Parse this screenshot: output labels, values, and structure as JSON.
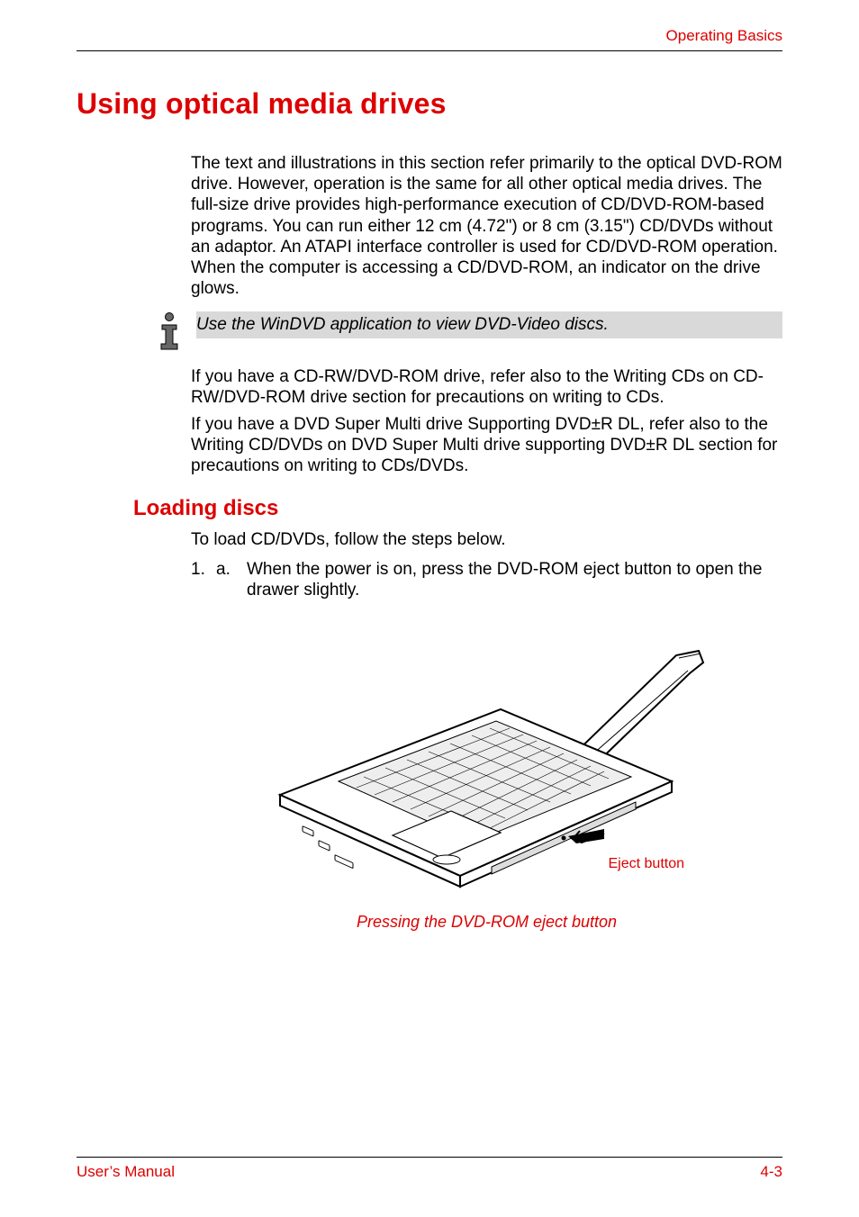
{
  "header": {
    "section": "Operating Basics"
  },
  "headings": {
    "main": "Using optical media drives",
    "sub1": "Loading discs"
  },
  "paragraphs": {
    "intro": "The text and illustrations in this section refer primarily to the optical DVD-ROM drive. However, operation is the same for all other optical media drives. The full-size drive provides high-performance execution of CD/DVD-ROM-based programs. You can run either 12 cm (4.72\") or 8 cm (3.15\") CD/DVDs without an adaptor. An ATAPI interface controller is used for CD/DVD-ROM operation. When the computer is accessing a CD/DVD-ROM, an indicator on the drive glows.",
    "note": "Use the WinDVD application to view DVD-Video discs.",
    "after_note_1": "If you have a CD-RW/DVD-ROM drive, refer also to the Writing CDs on CD-RW/DVD-ROM drive section for precautions on writing to CDs.",
    "after_note_2": "If you have a DVD Super Multi drive Supporting DVD±R DL, refer also to the Writing CD/DVDs on DVD Super Multi drive supporting DVD±R DL section for precautions on writing to CDs/DVDs.",
    "load_intro": "To load CD/DVDs, follow the steps below."
  },
  "steps": {
    "s1": {
      "num": "1.",
      "alpha": "a.",
      "text": "When the power is on, press the DVD-ROM eject button to open the drawer slightly."
    }
  },
  "figure": {
    "callout": "Eject button",
    "caption": "Pressing the DVD-ROM eject button"
  },
  "footer": {
    "left": "User’s Manual",
    "right": "4-3"
  }
}
